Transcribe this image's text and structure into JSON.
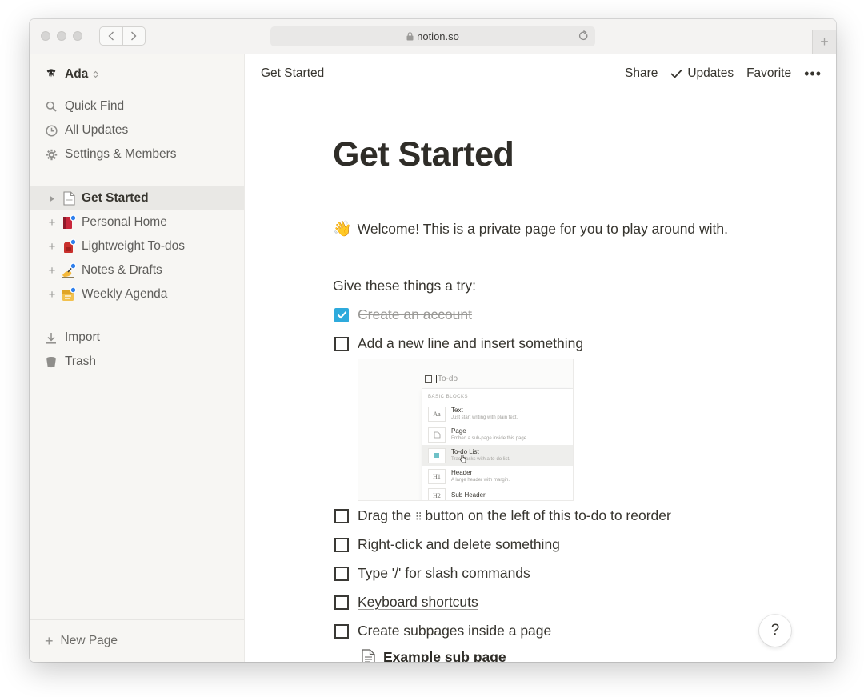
{
  "browser": {
    "url": "notion.so",
    "new_tab_label": "+"
  },
  "workspace": {
    "name": "Ada"
  },
  "sidebar": {
    "nav": [
      {
        "label": "Quick Find",
        "icon": "search-icon"
      },
      {
        "label": "All Updates",
        "icon": "clock-icon"
      },
      {
        "label": "Settings & Members",
        "icon": "gear-icon"
      }
    ],
    "pages": [
      {
        "label": "Get Started",
        "icon": "document-icon",
        "active": true
      },
      {
        "label": "Personal Home",
        "icon": "book-icon"
      },
      {
        "label": "Lightweight To-dos",
        "icon": "backpack-icon"
      },
      {
        "label": "Notes & Drafts",
        "icon": "writing-hand-icon"
      },
      {
        "label": "Weekly Agenda",
        "icon": "calendar-icon"
      }
    ],
    "tools": [
      {
        "label": "Import",
        "icon": "download-icon"
      },
      {
        "label": "Trash",
        "icon": "trash-icon"
      }
    ],
    "new_page": "New Page"
  },
  "topbar": {
    "breadcrumb": "Get Started",
    "share": "Share",
    "updates": "Updates",
    "favorite": "Favorite",
    "more": "•••"
  },
  "page": {
    "title": "Get Started",
    "welcome_emoji": "👋",
    "welcome": "Welcome! This is a private page for you to play around with.",
    "intro": "Give these things a try:",
    "todos": [
      {
        "text": "Create an account",
        "checked": true
      },
      {
        "text": "Add a new line and insert something",
        "checked": false
      },
      {
        "text_before": "Drag the",
        "grip": "⁝⁝",
        "text_after": "button on the left of this to-do to reorder",
        "checked": false
      },
      {
        "text": "Right-click and delete something",
        "checked": false
      },
      {
        "text": "Type '/' for slash commands",
        "checked": false
      },
      {
        "text": "Keyboard shortcuts",
        "checked": false,
        "link": true
      },
      {
        "text": "Create subpages inside a page",
        "checked": false
      }
    ],
    "subpage": "Example sub page"
  },
  "embedded_image": {
    "todo_placeholder": "To-do",
    "section_header": "BASIC BLOCKS",
    "items": [
      {
        "icon_text": "Aa",
        "title": "Text",
        "desc": "Just start writing with plain text."
      },
      {
        "icon_text": "",
        "title": "Page",
        "desc": "Embed a sub-page inside this page."
      },
      {
        "icon_text": "",
        "title": "To-do List",
        "desc": "Track tasks with a to-do list.",
        "highlighted": true
      },
      {
        "icon_text": "H1",
        "title": "Header",
        "desc": "A large header with margin."
      },
      {
        "icon_text": "H2",
        "title": "Sub Header",
        "desc": ""
      }
    ]
  },
  "help_button": "?"
}
